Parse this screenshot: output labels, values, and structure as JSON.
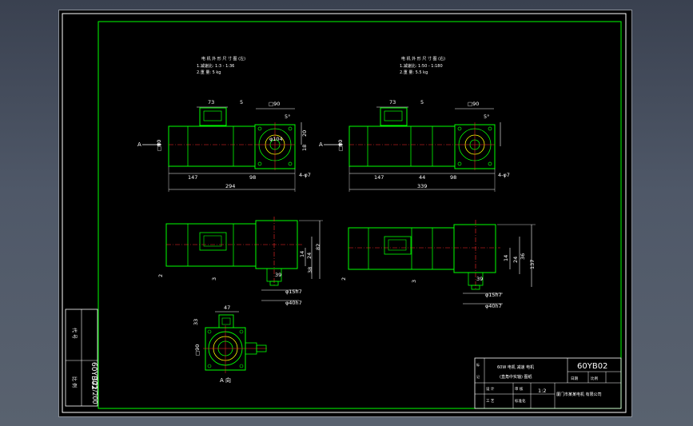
{
  "title_block": {
    "drawing_code": "60YB02",
    "product_name_line1": "60W 电机 减速 电机",
    "product_name_line2": "(直角中实轴)  图纸",
    "ratio": "1:2",
    "company": "厦门市某某电机 有限公司",
    "cells": [
      "设 计",
      "审 核",
      "工 艺",
      "标准化",
      "日期",
      "比例"
    ]
  },
  "side_strip": {
    "code_vertical": "60YB02",
    "scale_vertical": "121/200",
    "label_top": "代 号",
    "label_bottom": "比 例"
  },
  "view_left": {
    "note_line1": "电 机 外 形 尺 寸 图 (左)",
    "note_line2": "1.减速比: 1:3 - 1:36",
    "note_line3": "2.重 量: 5 kg",
    "arrow_label": "A",
    "dims": {
      "d73": "73",
      "d5": "5",
      "box90": "□90",
      "angle": "5°",
      "d147": "147",
      "d98": "98",
      "holes": "4-φ7",
      "total": "294",
      "pcd": "φ104",
      "d20": "20",
      "d18": "18",
      "box80": "□80"
    }
  },
  "view_right": {
    "note_line1": "电 机 外 形 尺 寸 图 (右)",
    "note_line2": "1.减速比: 1:50 - 1:180",
    "note_line3": "2.重 量: 5.5 kg",
    "arrow_label": "A",
    "dims": {
      "d73": "73",
      "d5": "5",
      "box90": "□90",
      "angle": "5°",
      "d147": "147",
      "d44": "44",
      "d98": "98",
      "holes": "4-φ7",
      "total": "339",
      "box80": "□80"
    }
  },
  "front_left": {
    "d2a": "2",
    "d3": "3",
    "d14": "14",
    "d24": "24",
    "d38": "38",
    "d82": "82",
    "d39": "39",
    "shaft": "φ15h7",
    "flange": "φ40h7"
  },
  "front_right": {
    "d2a": "2",
    "d3": "3",
    "d14": "14",
    "d24": "24",
    "d36": "36",
    "d137": "137",
    "d39": "39",
    "shaft": "φ15h7",
    "flange": "φ40h7"
  },
  "view_a": {
    "title": "A 向",
    "d47": "47",
    "d33": "33",
    "box90": "□90"
  }
}
